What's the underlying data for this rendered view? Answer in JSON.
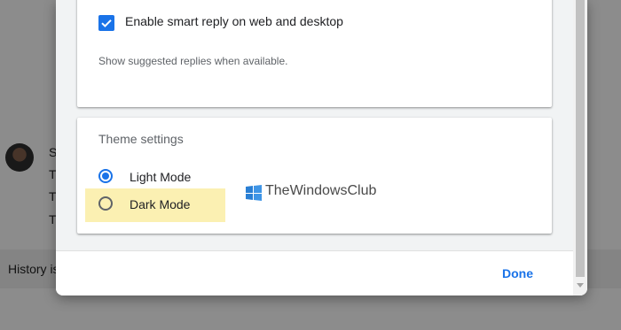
{
  "background": {
    "row_letters": [
      "S",
      "T",
      "T",
      "T"
    ],
    "history_text": "History is"
  },
  "dialog": {
    "smart_reply": {
      "checkbox_label": "Enable smart reply on web and desktop",
      "checked": true,
      "description": "Show suggested replies when available."
    },
    "theme": {
      "title": "Theme settings",
      "options": [
        {
          "label": "Light Mode",
          "selected": true
        },
        {
          "label": "Dark Mode",
          "selected": false
        }
      ]
    },
    "watermark": "TheWindowsClub",
    "done_label": "Done"
  },
  "colors": {
    "accent": "#1a73e8",
    "highlight": "#fbf0b2"
  }
}
